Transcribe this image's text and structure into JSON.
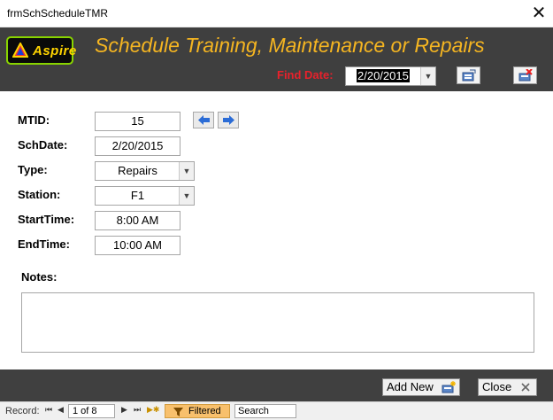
{
  "window": {
    "title": "frmSchScheduleTMR",
    "close_glyph": "✕"
  },
  "header": {
    "logo_text": "Aspire",
    "heading": "Schedule Training, Maintenance or Repairs",
    "find_date_label": "Find Date:",
    "find_date_value": "2/20/2015",
    "find_button_icon": "find-record-icon",
    "delete_button_icon": "delete-record-icon",
    "colors": {
      "background": "#3f3f3f",
      "heading": "#f5b521",
      "find_label": "#e8212b"
    }
  },
  "form": {
    "mtid": {
      "label": "MTID:",
      "value": "15"
    },
    "schdate": {
      "label": "SchDate:",
      "value": "2/20/2015"
    },
    "type": {
      "label": "Type:",
      "value": "Repairs"
    },
    "station": {
      "label": "Station:",
      "value": "F1"
    },
    "starttime": {
      "label": "StartTime:",
      "value": "8:00 AM"
    },
    "endtime": {
      "label": "EndTime:",
      "value": "10:00 AM"
    },
    "notes": {
      "label": "Notes:",
      "value": ""
    },
    "prev_icon": "arrow-left-icon",
    "next_icon": "arrow-right-icon"
  },
  "footer": {
    "add_new_label": "Add New",
    "close_label": "Close"
  },
  "statusbar": {
    "record_label": "Record:",
    "position": "1 of 8",
    "filter_label": "Filtered",
    "search_label": "Search",
    "first_glyph": "⏮",
    "prev_glyph": "◀",
    "next_glyph": "▶",
    "last_glyph": "⏭",
    "new_glyph": "▶✱"
  }
}
